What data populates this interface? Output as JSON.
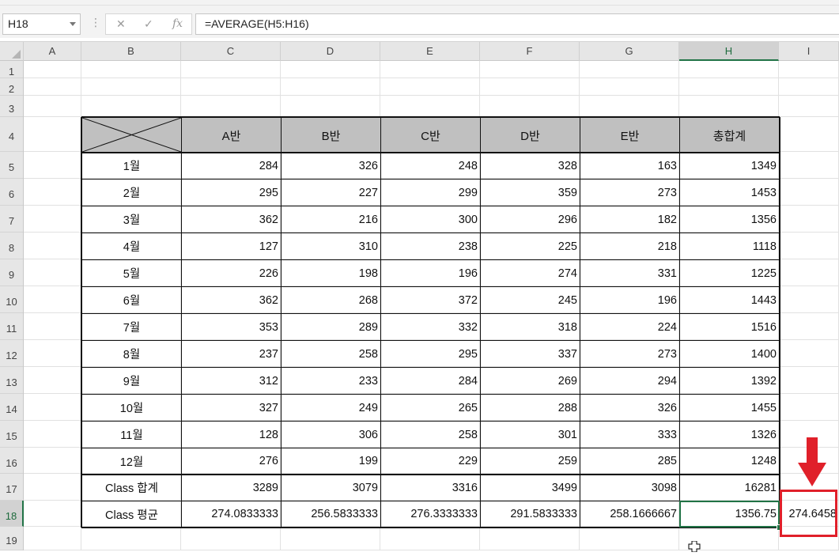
{
  "formula_bar": {
    "name_box": "H18",
    "cancel_icon": "✕",
    "enter_icon": "✓",
    "function_icon": "fx",
    "formula": "=AVERAGE(H5:H16)"
  },
  "columns": [
    "A",
    "B",
    "C",
    "D",
    "E",
    "F",
    "G",
    "H",
    "I"
  ],
  "rows": [
    "1",
    "2",
    "3",
    "4",
    "5",
    "6",
    "7",
    "8",
    "9",
    "10",
    "11",
    "12",
    "13",
    "14",
    "15",
    "16",
    "17",
    "18",
    "19"
  ],
  "selected": {
    "column": "H",
    "row": "18"
  },
  "table": {
    "headers": [
      "A반",
      "B반",
      "C반",
      "D반",
      "E반",
      "총합계"
    ],
    "body": [
      {
        "label": "1월",
        "values": [
          "284",
          "326",
          "248",
          "328",
          "163",
          "1349"
        ]
      },
      {
        "label": "2월",
        "values": [
          "295",
          "227",
          "299",
          "359",
          "273",
          "1453"
        ]
      },
      {
        "label": "3월",
        "values": [
          "362",
          "216",
          "300",
          "296",
          "182",
          "1356"
        ]
      },
      {
        "label": "4월",
        "values": [
          "127",
          "310",
          "238",
          "225",
          "218",
          "1118"
        ]
      },
      {
        "label": "5월",
        "values": [
          "226",
          "198",
          "196",
          "274",
          "331",
          "1225"
        ]
      },
      {
        "label": "6월",
        "values": [
          "362",
          "268",
          "372",
          "245",
          "196",
          "1443"
        ]
      },
      {
        "label": "7월",
        "values": [
          "353",
          "289",
          "332",
          "318",
          "224",
          "1516"
        ]
      },
      {
        "label": "8월",
        "values": [
          "237",
          "258",
          "295",
          "337",
          "273",
          "1400"
        ]
      },
      {
        "label": "9월",
        "values": [
          "312",
          "233",
          "284",
          "269",
          "294",
          "1392"
        ]
      },
      {
        "label": "10월",
        "values": [
          "327",
          "249",
          "265",
          "288",
          "326",
          "1455"
        ]
      },
      {
        "label": "11월",
        "values": [
          "128",
          "306",
          "258",
          "301",
          "333",
          "1326"
        ]
      },
      {
        "label": "12월",
        "values": [
          "276",
          "199",
          "229",
          "259",
          "285",
          "1248"
        ]
      }
    ],
    "totals": {
      "label": "Class 합계",
      "values": [
        "3289",
        "3079",
        "3316",
        "3499",
        "3098",
        "16281"
      ]
    },
    "averages": {
      "label": "Class 평균",
      "values": [
        "274.0833333",
        "256.5833333",
        "276.3333333",
        "291.5833333",
        "258.1666667",
        "1356.75"
      ]
    }
  },
  "highlighted_cell": {
    "value": "274.6458",
    "highlight_color": "#e0202a"
  },
  "colors": {
    "accent": "#217346",
    "header_fill": "#c0c0c0",
    "annotation": "#e0202a"
  }
}
